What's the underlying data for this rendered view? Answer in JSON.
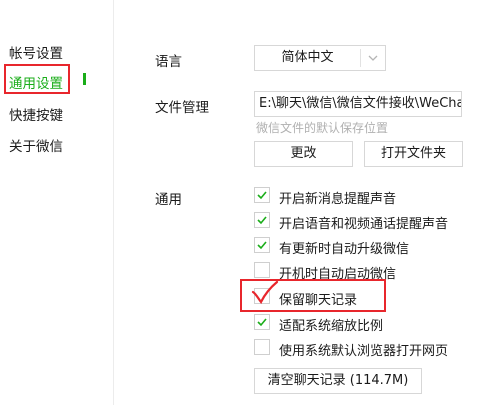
{
  "sidebar": {
    "items": [
      {
        "label": "帐号设置"
      },
      {
        "label": "通用设置"
      },
      {
        "label": "快捷按键"
      },
      {
        "label": "关于微信"
      }
    ]
  },
  "language": {
    "label": "语言",
    "value": "简体中文"
  },
  "file_management": {
    "label": "文件管理",
    "path": "E:\\聊天\\微信\\微信文件接收\\WeChat Files",
    "hint": "微信文件的默认保存位置",
    "change_button": "更改",
    "open_folder_button": "打开文件夹"
  },
  "general": {
    "label": "通用",
    "options": [
      {
        "label": "开启新消息提醒声音",
        "checked": true
      },
      {
        "label": "开启语音和视频通话提醒声音",
        "checked": true
      },
      {
        "label": "有更新时自动升级微信",
        "checked": true
      },
      {
        "label": "开机时自动启动微信",
        "checked": false
      },
      {
        "label": "保留聊天记录",
        "checked": true
      },
      {
        "label": "适配系统缩放比例",
        "checked": true
      },
      {
        "label": "使用系统默认浏览器打开网页",
        "checked": false
      }
    ],
    "clear_history_button": "清空聊天记录 (114.7M)"
  },
  "colors": {
    "accent": "#1aad19",
    "annotation": "#e8262c"
  }
}
